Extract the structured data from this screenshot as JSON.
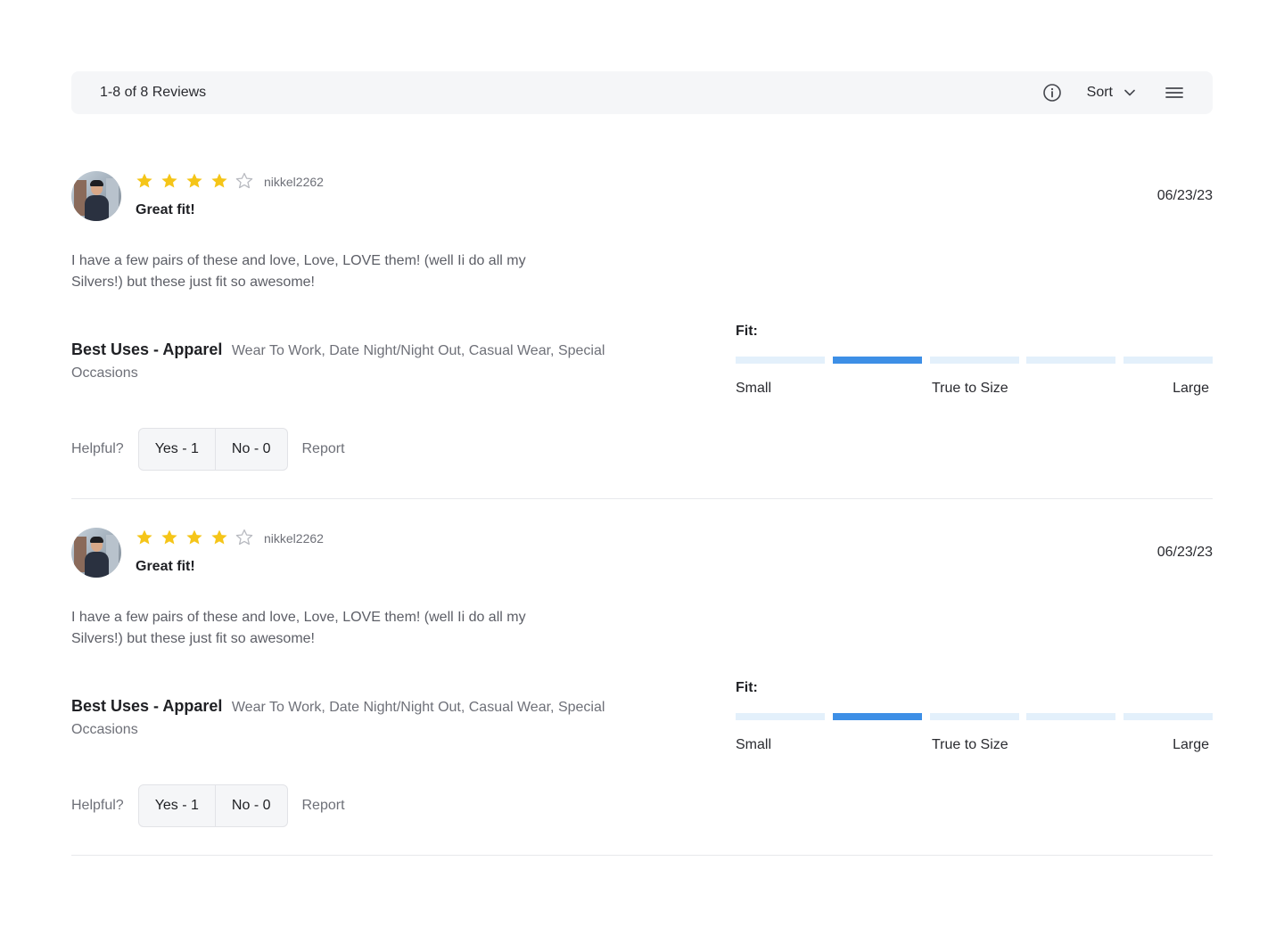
{
  "toolbar": {
    "count_text": "1-8 of 8 Reviews",
    "sort_label": "Sort",
    "icons": [
      "info-icon",
      "chevron-down-icon",
      "menu-icon"
    ]
  },
  "colors": {
    "star_filled": "#f5c518",
    "star_empty": "#b8bac0",
    "fit_active": "#3d8fe6",
    "fit_inactive": "#e3f0fb",
    "toolbar_bg": "#f5f6f8"
  },
  "reviews": [
    {
      "rating": 4,
      "max_rating": 5,
      "username": "nikkel2262",
      "title": "Great fit!",
      "date": "06/23/23",
      "body": "I have a few pairs of these and love, Love, LOVE them! (well Ii do all my Silvers!) but these just fit so awesome!",
      "best_uses_label": "Best Uses - Apparel",
      "best_uses_values": "Wear To Work, Date Night/Night   Out, Casual Wear, Special Occasions",
      "fit": {
        "label": "Fit:",
        "segments": 5,
        "selected_index": 1,
        "scale_small": "Small",
        "scale_mid": "True to Size",
        "scale_large": "Large"
      },
      "helpful": {
        "label": "Helpful?",
        "yes_label": "Yes - 1",
        "no_label": "No - 0",
        "report_label": "Report"
      }
    },
    {
      "rating": 4,
      "max_rating": 5,
      "username": "nikkel2262",
      "title": "Great fit!",
      "date": "06/23/23",
      "body": "I have a few pairs of these and love, Love, LOVE them! (well Ii do all my Silvers!) but these just fit so awesome!",
      "best_uses_label": "Best Uses - Apparel",
      "best_uses_values": "Wear To Work, Date Night/Night   Out, Casual Wear, Special Occasions",
      "fit": {
        "label": "Fit:",
        "segments": 5,
        "selected_index": 1,
        "scale_small": "Small",
        "scale_mid": "True to Size",
        "scale_large": "Large"
      },
      "helpful": {
        "label": "Helpful?",
        "yes_label": "Yes - 1",
        "no_label": "No - 0",
        "report_label": "Report"
      }
    }
  ]
}
